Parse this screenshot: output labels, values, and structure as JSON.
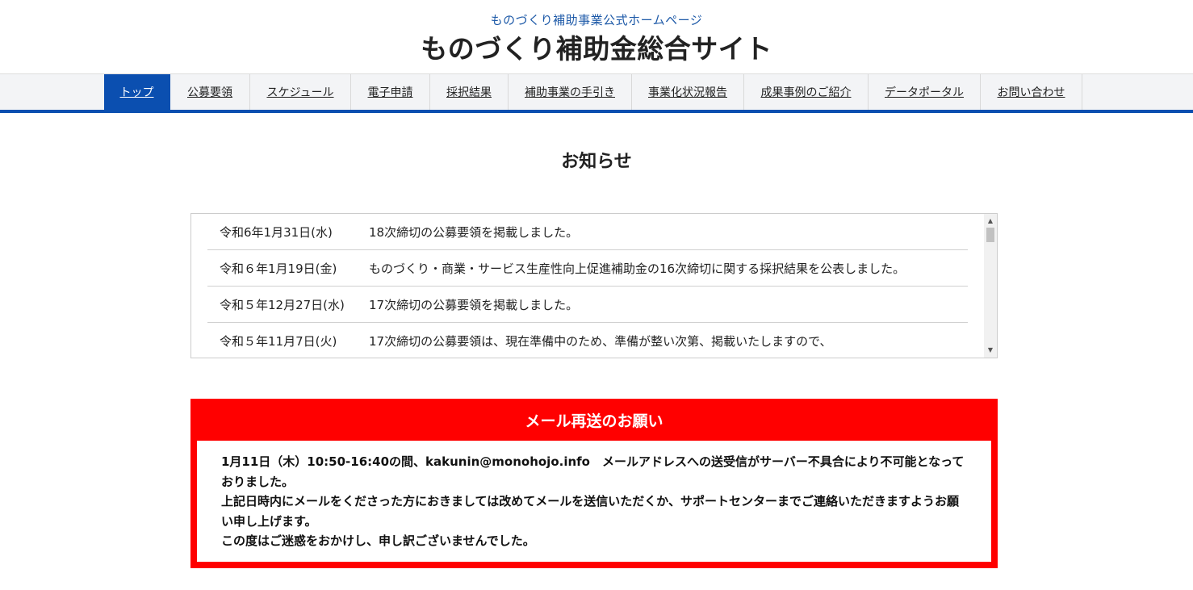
{
  "header": {
    "subtitle": "ものづくり補助事業公式ホームページ",
    "title": "ものづくり補助金総合サイト"
  },
  "nav": {
    "items": [
      {
        "label": "トップ",
        "active": true
      },
      {
        "label": "公募要領",
        "active": false
      },
      {
        "label": "スケジュール",
        "active": false
      },
      {
        "label": "電子申請",
        "active": false
      },
      {
        "label": "採択結果",
        "active": false
      },
      {
        "label": "補助事業の手引き",
        "active": false
      },
      {
        "label": "事業化状況報告",
        "active": false
      },
      {
        "label": "成果事例のご紹介",
        "active": false
      },
      {
        "label": "データポータル",
        "active": false
      },
      {
        "label": "お問い合わせ",
        "active": false
      }
    ]
  },
  "news": {
    "heading": "お知らせ",
    "items": [
      {
        "date": "令和6年1月31日(水)",
        "text": "18次締切の公募要領を掲載しました。"
      },
      {
        "date": "令和６年1月19日(金)",
        "text": "ものづくり・商業・サービス生産性向上促進補助金の16次締切に関する採択結果を公表しました。"
      },
      {
        "date": "令和５年12月27日(水)",
        "text": "17次締切の公募要領を掲載しました。"
      },
      {
        "date": "令和５年11月7日(火)",
        "text": "17次締切の公募要領は、現在準備中のため、準備が整い次第、掲載いたしますので、"
      }
    ],
    "scroll_up_icon": "▲",
    "scroll_down_icon": "▼"
  },
  "notice": {
    "title": "メール再送のお願い",
    "lines": [
      "1月11日（木）10:50-16:40の間、kakunin@monohojo.info　メールアドレスへの送受信がサーバー不具合により不可能となっておりました。",
      "上記日時内にメールをくださった方におきましては改めてメールを送信いただくか、サポートセンターまでご連絡いただきますようお願い申し上げます。",
      "この度はご迷惑をおかけし、申し訳ございませんでした。"
    ]
  },
  "colors": {
    "brand_blue": "#0b4fb0",
    "notice_red": "#ff0000",
    "subtitle_blue": "#1e5aa8"
  }
}
